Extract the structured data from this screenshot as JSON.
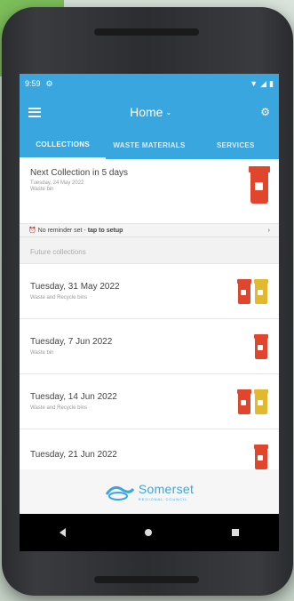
{
  "status": {
    "time": "9:59"
  },
  "toolbar": {
    "title": "Home"
  },
  "tabs": [
    {
      "label": "COLLECTIONS"
    },
    {
      "label": "WASTE MATERIALS"
    },
    {
      "label": "SERVICES"
    }
  ],
  "next": {
    "title": "Next Collection in 5 days",
    "date": "Tuesday, 24 May 2022",
    "type": "Waste bin"
  },
  "reminder": {
    "text": "No reminder set - ",
    "action": "tap to setup"
  },
  "future": {
    "header": "Future collections"
  },
  "collections": [
    {
      "date": "Tuesday, 31 May 2022",
      "desc": "Waste and Recycle bins",
      "bins": [
        "waste",
        "recycle"
      ]
    },
    {
      "date": "Tuesday, 7 Jun 2022",
      "desc": "Waste bin",
      "bins": [
        "waste"
      ]
    },
    {
      "date": "Tuesday, 14 Jun 2022",
      "desc": "Waste and Recycle bins",
      "bins": [
        "waste",
        "recycle"
      ]
    },
    {
      "date": "Tuesday, 21 Jun 2022",
      "desc": "",
      "bins": [
        "waste"
      ]
    }
  ],
  "footer": {
    "logo": "Somerset",
    "sub": "REGIONAL COUNCIL"
  },
  "colors": {
    "primary": "#3aa6e0",
    "waste_bin": "#e1452c",
    "recycle_bin": "#e3b72e"
  }
}
